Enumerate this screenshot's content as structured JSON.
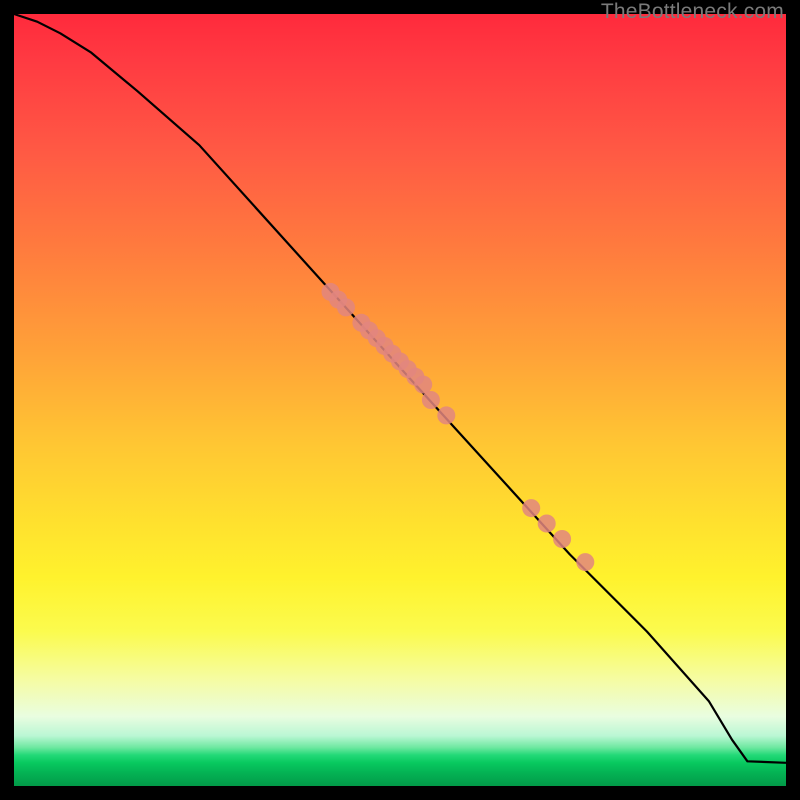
{
  "watermark": "TheBottleneck.com",
  "colors": {
    "dot": "#e2867f",
    "line": "#000000"
  },
  "chart_data": {
    "type": "line",
    "title": "",
    "xlabel": "",
    "ylabel": "",
    "xlim": [
      0,
      100
    ],
    "ylim": [
      0,
      100
    ],
    "series": [
      {
        "name": "curve",
        "x": [
          0,
          3,
          6,
          10,
          16,
          24,
          52,
          62,
          72,
          82,
          90,
          93,
          95,
          100
        ],
        "y": [
          100,
          99,
          97.5,
          95,
          90,
          83,
          52,
          41,
          30,
          20,
          11,
          6,
          3.2,
          3.0
        ]
      }
    ],
    "points": {
      "name": "highlighted-dots",
      "x": [
        41,
        42,
        43,
        45,
        46,
        47,
        48,
        49,
        50,
        51,
        52,
        53,
        54,
        56,
        67,
        69,
        71,
        74
      ],
      "y": [
        64,
        63,
        62,
        60,
        59,
        58,
        57,
        56,
        55,
        54,
        53,
        52,
        50,
        48,
        36,
        34,
        32,
        29
      ],
      "r": 9
    }
  }
}
